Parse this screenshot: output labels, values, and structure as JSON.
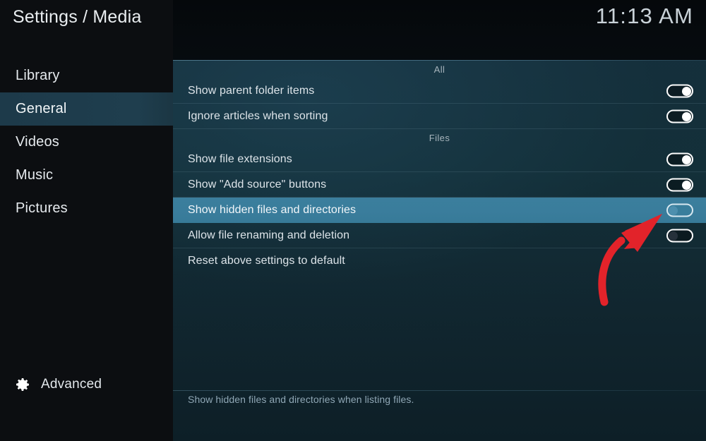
{
  "window": {
    "title": "Settings / Media",
    "clock": "11:13 AM"
  },
  "sidebar": {
    "items": [
      {
        "label": "Library",
        "selected": false
      },
      {
        "label": "General",
        "selected": true
      },
      {
        "label": "Videos",
        "selected": false
      },
      {
        "label": "Music",
        "selected": false
      },
      {
        "label": "Pictures",
        "selected": false
      }
    ],
    "advanced": {
      "label": "Advanced",
      "icon": "gear-icon"
    }
  },
  "main": {
    "sections": [
      {
        "header": "All",
        "rows": [
          {
            "label": "Show parent folder items",
            "control": "toggle",
            "value": "on",
            "highlighted": false
          },
          {
            "label": "Ignore articles when sorting",
            "control": "toggle",
            "value": "on",
            "highlighted": false
          }
        ]
      },
      {
        "header": "Files",
        "rows": [
          {
            "label": "Show file extensions",
            "control": "toggle",
            "value": "on",
            "highlighted": false
          },
          {
            "label": "Show \"Add source\" buttons",
            "control": "toggle",
            "value": "on",
            "highlighted": false
          },
          {
            "label": "Show hidden files and directories",
            "control": "toggle",
            "value": "off",
            "highlighted": true
          },
          {
            "label": "Allow file renaming and deletion",
            "control": "toggle",
            "value": "off",
            "highlighted": false
          },
          {
            "label": "Reset above settings to default",
            "control": "none",
            "value": "",
            "highlighted": false
          }
        ]
      }
    ],
    "help_text": "Show hidden files and directories when listing files."
  },
  "annotation": {
    "type": "curved-arrow",
    "color": "#e2232a",
    "points_to": "show-hidden-files-toggle"
  },
  "colors": {
    "sidebar_bg": "#0c0e11",
    "sidebar_selected": "#1e3c4c",
    "row_highlight": "#3a7e9c",
    "panel_top": "#15303c",
    "panel_bottom": "#0d1f27",
    "text_primary": "#dde4e9",
    "text_muted": "#8fa7b5",
    "annotation_red": "#e2232a"
  }
}
